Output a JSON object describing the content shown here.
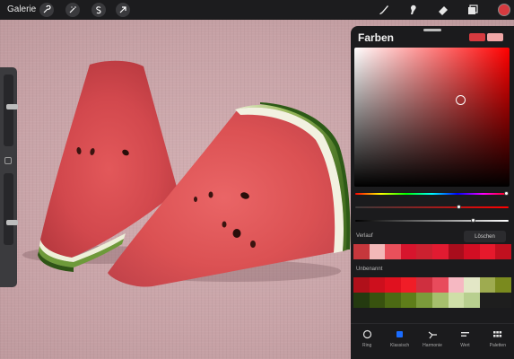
{
  "topbar": {
    "gallery_label": "Galerie",
    "left_tools": [
      "wrench-icon",
      "magic-wand-icon",
      "selection-s-icon",
      "transform-arrow-icon"
    ],
    "right_tools": [
      "brush-icon",
      "smudge-icon",
      "eraser-icon",
      "layers-icon"
    ],
    "active_color": "#d63a3f"
  },
  "sidebar": {
    "size_slider_level": 0.55,
    "opacity_slider_level": 0.3
  },
  "color_panel": {
    "title": "Farben",
    "current_color": "#d63a3f",
    "previous_color": "#f1a7a7",
    "hue_level": 0.99,
    "saturation_level": 0.68,
    "brightness_level": 0.77,
    "history": {
      "label": "Verlauf",
      "clear_label": "Löschen",
      "colors": [
        "#c6373c",
        "#f2b8b8",
        "#e9505b",
        "#d7152d",
        "#cc2130",
        "#e11b31",
        "#a90d1c",
        "#d10e23",
        "#e6192c",
        "#c1101f"
      ]
    },
    "palette": {
      "label": "Unbenannt",
      "colors": [
        "#b0101a",
        "#cd0f1d",
        "#e0111f",
        "#f01d27",
        "#cf2f3f",
        "#e84b5c",
        "#f6b8c2",
        "#e3e7c6",
        "#9eab50",
        "#7a8a1e",
        "#243a10",
        "#38520f",
        "#4c6a14",
        "#5e7e1a",
        "#7b9b3b",
        "#a6bf6d",
        "#cfdfa8",
        "#b8cf8f",
        "#1e1e1e",
        "#1e1e1e"
      ]
    },
    "tabs": [
      {
        "label": "Ring",
        "icon": "ring-icon"
      },
      {
        "label": "Klassisch",
        "icon": "classic-square-icon"
      },
      {
        "label": "Harmonie",
        "icon": "harmony-icon"
      },
      {
        "label": "Wert",
        "icon": "value-sliders-icon"
      },
      {
        "label": "Paletten",
        "icon": "palettes-grid-icon"
      }
    ],
    "active_tab": "Klassisch",
    "active_tab_color": "#1a6cff"
  }
}
